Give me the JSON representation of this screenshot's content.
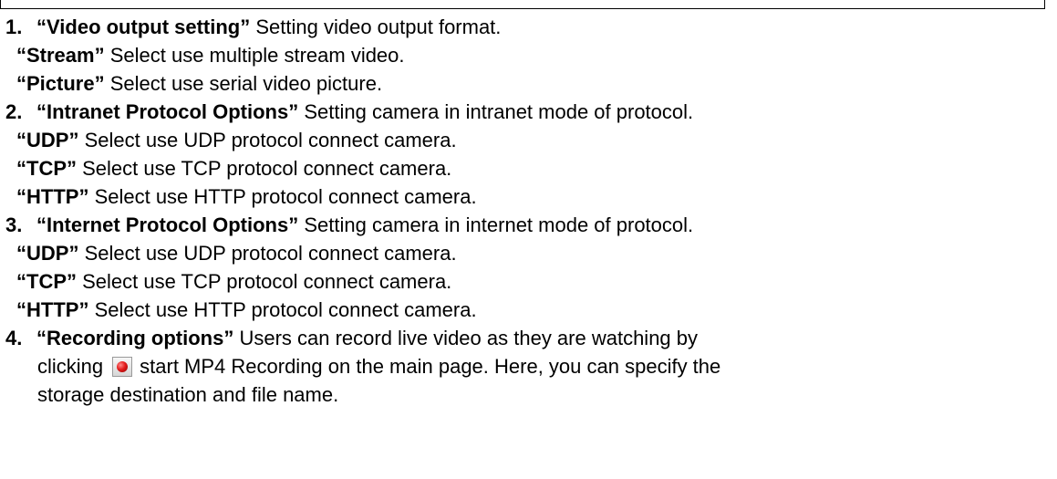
{
  "items": [
    {
      "number": "1.",
      "title": "“Video output setting”",
      "desc": " Setting video output format.",
      "options": [
        {
          "name": "“Stream”",
          "desc": " Select use multiple stream video."
        },
        {
          "name": "“Picture”",
          "desc": " Select use serial video picture."
        }
      ]
    },
    {
      "number": "2.",
      "title": "“Intranet Protocol Options”",
      "desc": " Setting camera in intranet mode of protocol.",
      "options": [
        {
          "name": "“UDP”",
          "desc": " Select use UDP protocol connect camera."
        },
        {
          "name": "“TCP”",
          "desc": " Select use TCP protocol connect camera."
        },
        {
          "name": "“HTTP”",
          "desc": " Select use HTTP protocol connect camera."
        }
      ]
    },
    {
      "number": "3.",
      "title": "“Internet Protocol Options”",
      "desc": " Setting camera in internet mode of protocol.",
      "options": [
        {
          "name": "“UDP”",
          "desc": " Select use UDP protocol connect camera."
        },
        {
          "name": "“TCP”",
          "desc": " Select use TCP protocol connect camera."
        },
        {
          "name": "“HTTP”",
          "desc": " Select use HTTP protocol connect camera."
        }
      ]
    },
    {
      "number": "4.",
      "title": "“Recording options”",
      "desc": " Users can record live video as they are watching by",
      "line2_before_icon": "clicking",
      "line2_after_icon": "start MP4 Recording on the main page. Here, you can specify the",
      "line3": "storage destination and file name.",
      "icon": "record-icon",
      "icon_color": "#e41b1b"
    }
  ]
}
